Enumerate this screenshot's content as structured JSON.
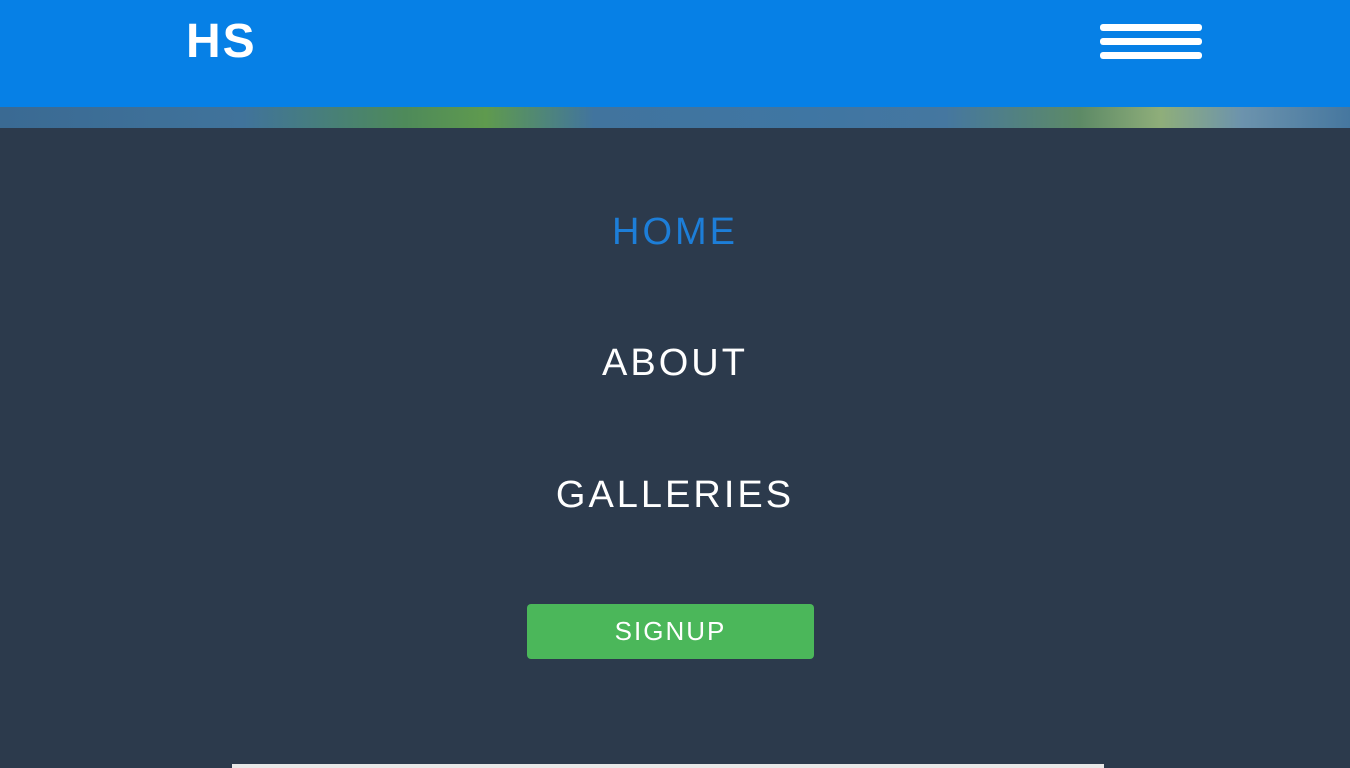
{
  "header": {
    "logo_text": "HS",
    "menu_icon": "hamburger-menu-icon",
    "background_color": "#0680e6"
  },
  "nav": {
    "items": [
      {
        "label": "HOME",
        "active": true,
        "color": "#1d7ed8"
      },
      {
        "label": "ABOUT",
        "active": false,
        "color": "#ffffff"
      },
      {
        "label": "GALLERIES",
        "active": false,
        "color": "#ffffff"
      }
    ],
    "background_color": "#2c3a4c"
  },
  "signup": {
    "label": "SIGNUP",
    "color": "#4bb75a"
  }
}
